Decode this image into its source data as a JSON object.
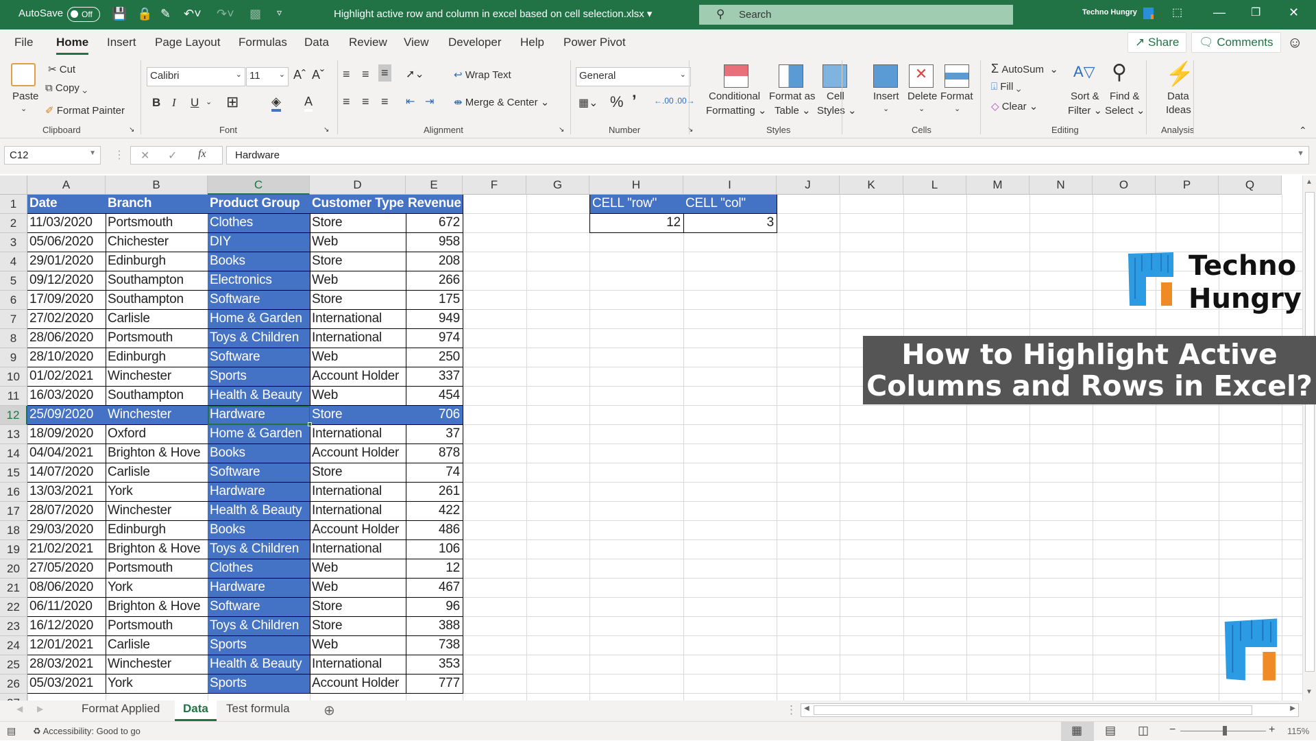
{
  "titlebar": {
    "autosave_label": "AutoSave",
    "autosave_state": "Off",
    "document_title": "Highlight active row and column in excel based on cell selection.xlsx",
    "search_placeholder": "Search",
    "user_name": "Techno Hungry"
  },
  "menu": {
    "tabs": [
      "File",
      "Home",
      "Insert",
      "Page Layout",
      "Formulas",
      "Data",
      "Review",
      "View",
      "Developer",
      "Help",
      "Power Pivot"
    ],
    "active_tab": "Home",
    "share_label": "Share",
    "comments_label": "Comments"
  },
  "ribbon": {
    "clipboard": {
      "paste": "Paste",
      "cut": "Cut",
      "copy": "Copy",
      "format_painter": "Format Painter",
      "label": "Clipboard"
    },
    "font": {
      "name": "Calibri",
      "size": "11",
      "label": "Font"
    },
    "alignment": {
      "wrap_text": "Wrap Text",
      "merge_center": "Merge & Center",
      "label": "Alignment"
    },
    "number": {
      "format": "General",
      "label": "Number"
    },
    "styles": {
      "conditional_1": "Conditional",
      "conditional_2": "Formatting",
      "table_1": "Format as",
      "table_2": "Table",
      "cell_1": "Cell",
      "cell_2": "Styles",
      "label": "Styles"
    },
    "cells": {
      "insert": "Insert",
      "delete": "Delete",
      "format": "Format",
      "label": "Cells"
    },
    "editing": {
      "autosum": "AutoSum",
      "fill": "Fill",
      "clear": "Clear",
      "sort_1": "Sort &",
      "sort_2": "Filter",
      "find_1": "Find &",
      "find_2": "Select",
      "label": "Editing"
    },
    "analysis": {
      "ideas_1": "Data",
      "ideas_2": "Ideas",
      "label": "Analysis"
    }
  },
  "formula_bar": {
    "name_box": "C12",
    "fx": "fx",
    "value": "Hardware"
  },
  "sheet": {
    "columns": [
      "A",
      "B",
      "C",
      "D",
      "E",
      "F",
      "G",
      "H",
      "I",
      "J",
      "K",
      "L",
      "M",
      "N",
      "O",
      "P",
      "Q"
    ],
    "active_cell": "C12",
    "active_row": 12,
    "active_col": 3,
    "headers": [
      "Date",
      "Branch",
      "Product Group",
      "Customer Type",
      "Revenue"
    ],
    "rows": [
      [
        "11/03/2020",
        "Portsmouth",
        "Clothes",
        "Store",
        "672"
      ],
      [
        "05/06/2020",
        "Chichester",
        "DIY",
        "Web",
        "958"
      ],
      [
        "29/01/2020",
        "Edinburgh",
        "Books",
        "Store",
        "208"
      ],
      [
        "09/12/2020",
        "Southampton",
        "Electronics",
        "Web",
        "266"
      ],
      [
        "17/09/2020",
        "Southampton",
        "Software",
        "Store",
        "175"
      ],
      [
        "27/02/2020",
        "Carlisle",
        "Home & Garden",
        "International",
        "949"
      ],
      [
        "28/06/2020",
        "Portsmouth",
        "Toys & Children",
        "International",
        "974"
      ],
      [
        "28/10/2020",
        "Edinburgh",
        "Software",
        "Web",
        "250"
      ],
      [
        "01/02/2021",
        "Winchester",
        "Sports",
        "Account Holder",
        "337"
      ],
      [
        "16/03/2020",
        "Southampton",
        "Health & Beauty",
        "Web",
        "454"
      ],
      [
        "25/09/2020",
        "Winchester",
        "Hardware",
        "Store",
        "706"
      ],
      [
        "18/09/2020",
        "Oxford",
        "Home & Garden",
        "International",
        "37"
      ],
      [
        "04/04/2021",
        "Brighton & Hove",
        "Books",
        "Account Holder",
        "878"
      ],
      [
        "14/07/2020",
        "Carlisle",
        "Software",
        "Store",
        "74"
      ],
      [
        "13/03/2021",
        "York",
        "Hardware",
        "International",
        "261"
      ],
      [
        "28/07/2020",
        "Winchester",
        "Health & Beauty",
        "International",
        "422"
      ],
      [
        "29/03/2020",
        "Edinburgh",
        "Books",
        "Account Holder",
        "486"
      ],
      [
        "21/02/2021",
        "Brighton & Hove",
        "Toys & Children",
        "International",
        "106"
      ],
      [
        "27/05/2020",
        "Portsmouth",
        "Clothes",
        "Web",
        "12"
      ],
      [
        "08/06/2020",
        "York",
        "Hardware",
        "Web",
        "467"
      ],
      [
        "06/11/2020",
        "Brighton & Hove",
        "Software",
        "Store",
        "96"
      ],
      [
        "16/12/2020",
        "Portsmouth",
        "Toys & Children",
        "Store",
        "388"
      ],
      [
        "12/01/2021",
        "Carlisle",
        "Sports",
        "Web",
        "738"
      ],
      [
        "28/03/2021",
        "Winchester",
        "Health & Beauty",
        "International",
        "353"
      ],
      [
        "05/03/2021",
        "York",
        "Sports",
        "Account Holder",
        "777"
      ]
    ],
    "info_headers": [
      "CELL \"row\"",
      "CELL \"col\""
    ],
    "info_values": [
      "12",
      "3"
    ]
  },
  "overlay": {
    "logo_line1": "Techno",
    "logo_line2": "Hungry",
    "banner_line1": "How to Highlight Active",
    "banner_line2": "Columns and Rows in Excel?"
  },
  "sheet_tabs": {
    "tabs": [
      "Format Applied",
      "Data",
      "Test formula"
    ],
    "active": "Data"
  },
  "status": {
    "accessibility": "Accessibility: Good to go",
    "zoom": "115%"
  },
  "colors": {
    "excel_green": "#217346",
    "highlight_blue": "#4472c4",
    "banner_gray": "#555555"
  }
}
